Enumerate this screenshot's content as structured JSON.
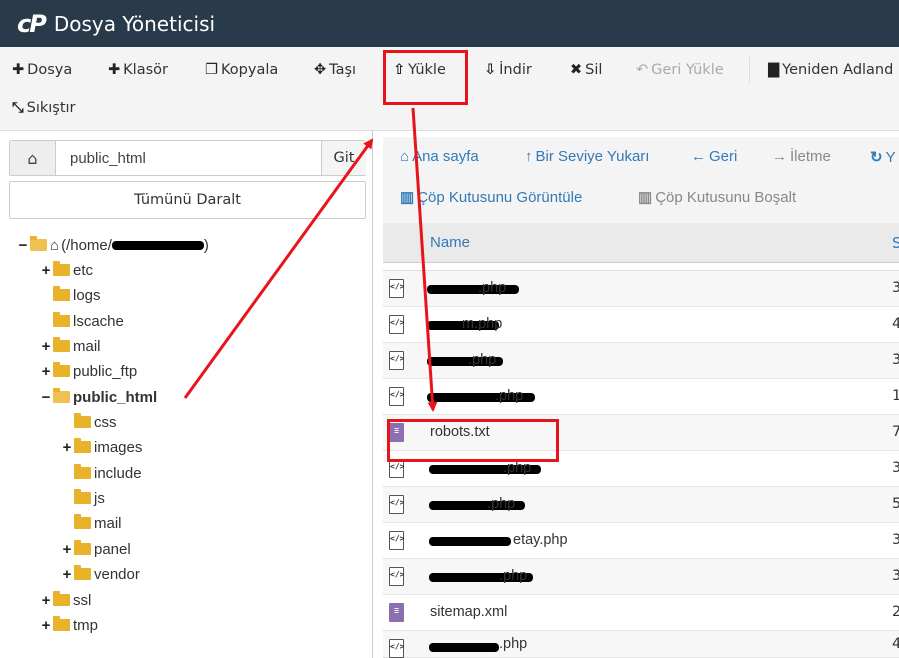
{
  "app": {
    "logo": "cP",
    "title": "Dosya Yöneticisi"
  },
  "toolbar": {
    "file": "Dosya",
    "folder": "Klasör",
    "copy": "Kopyala",
    "move": "Taşı",
    "upload": "Yükle",
    "download": "İndir",
    "delete": "Sil",
    "restore": "Geri Yükle",
    "rename": "Yeniden Adland",
    "compress": "Sıkıştır"
  },
  "left_panel": {
    "path_value": "public_html",
    "go_label": "Git",
    "collapse_all": "Tümünü Daralt",
    "tree": {
      "root_prefix": "(/home/",
      "root_suffix": ")",
      "etc": "etc",
      "logs": "logs",
      "lscache": "lscache",
      "mail": "mail",
      "public_ftp": "public_ftp",
      "public_html": "public_html",
      "css": "css",
      "images": "images",
      "include": "include",
      "js": "js",
      "ph_mail": "mail",
      "panel": "panel",
      "vendor": "vendor",
      "ssl": "ssl",
      "tmp": "tmp"
    }
  },
  "nav": {
    "home": "Ana sayfa",
    "up": "Bir Seviye Yukarı",
    "back": "Geri",
    "forward": "İletme",
    "reload": "Y",
    "view_trash": "Çöp Kutusunu Görüntüle",
    "empty_trash": "Çöp Kutusunu Boşalt"
  },
  "table": {
    "col_name": "Name",
    "col_size_partial": "S",
    "rows": [
      {
        "name": ".php",
        "size": "3"
      },
      {
        "name": "m.php",
        "size": "4"
      },
      {
        "name": ".php",
        "size": "3"
      },
      {
        "name": ".php",
        "size": "1"
      },
      {
        "name": "robots.txt",
        "size": "7"
      },
      {
        "name": ".php",
        "size": "3"
      },
      {
        "name": ".php",
        "size": "5"
      },
      {
        "name": "etay.php",
        "size": "3"
      },
      {
        "name": ".php",
        "size": "3"
      },
      {
        "name": "sitemap.xml",
        "size": "2"
      },
      {
        "name": ".php",
        "size": "4"
      }
    ]
  },
  "annotation_color": "#e8141c"
}
